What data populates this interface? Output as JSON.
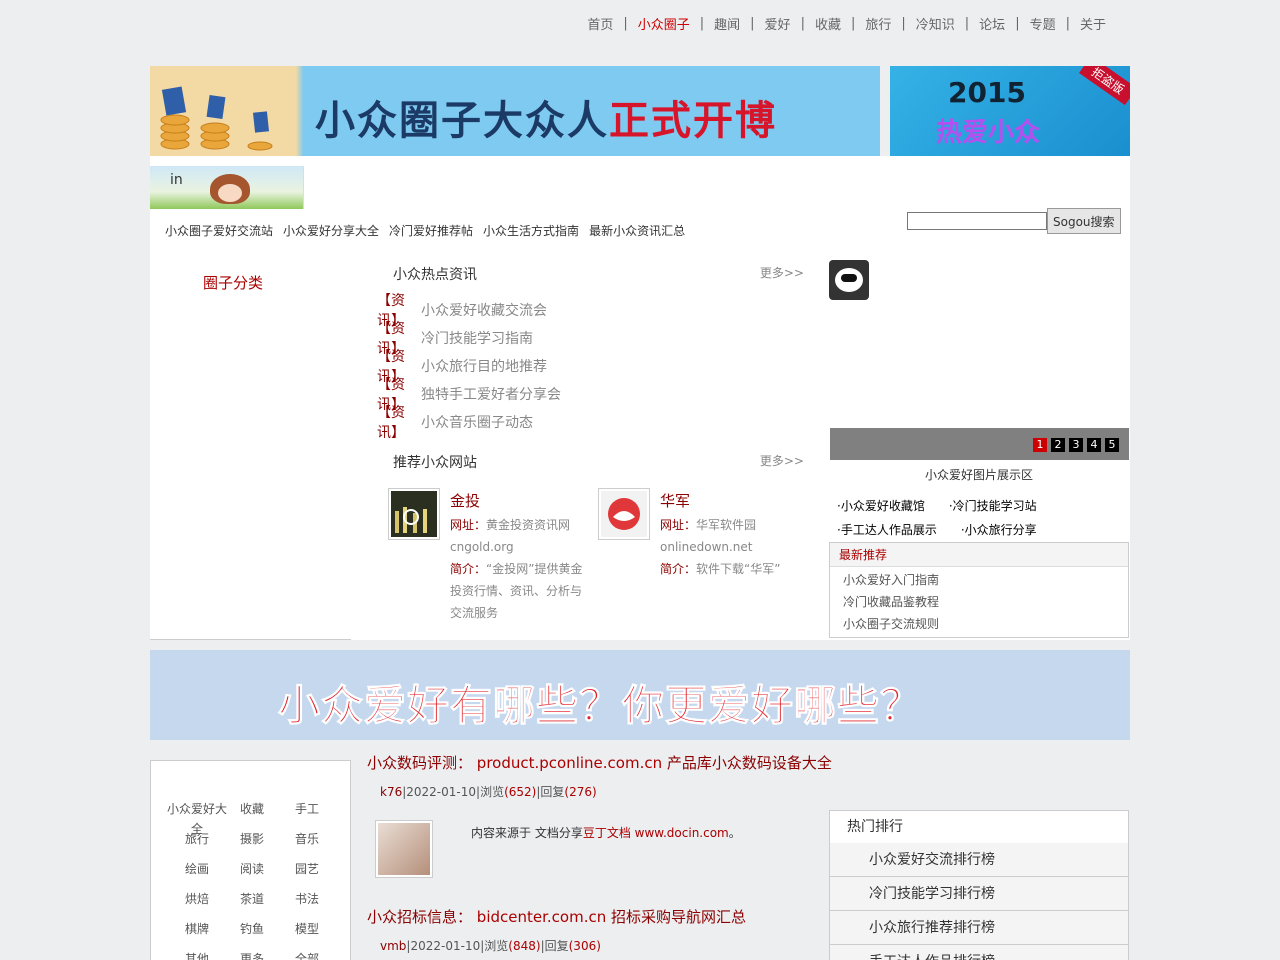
{
  "topnav": {
    "items": [
      {
        "label": "首页"
      },
      {
        "label": "小众圈子"
      },
      {
        "label": "趣闻"
      },
      {
        "label": "爱好"
      },
      {
        "label": "收藏"
      },
      {
        "label": "旅行"
      },
      {
        "label": "冷知识"
      },
      {
        "label": "论坛"
      },
      {
        "label": "专题"
      },
      {
        "label": "关于"
      }
    ],
    "active_index": 1,
    "separator": "|"
  },
  "banners": {
    "main": {
      "text_a": "小众圈子大众人",
      "text_b": "正式开博"
    },
    "side": {
      "year": "2015",
      "text": "热爱小众",
      "stamp": "拒盗版"
    },
    "mid": {
      "text": "小众爱好有哪些？你更爱好哪些？"
    }
  },
  "logo": {
    "text": "in"
  },
  "subnav": {
    "items": [
      "小众圈子爱好交流站",
      "小众爱好分享大全",
      "冷门爱好推荐帖",
      "小众生活方式指南",
      "最新小众资讯汇总"
    ]
  },
  "search": {
    "placeholder": "",
    "button": "Sogou搜索"
  },
  "left": {
    "head": "圈子分类"
  },
  "news": {
    "title": "小众热点资讯",
    "more": "更多>>",
    "rows": [
      {
        "tag": "【资讯】",
        "text": "小众爱好收藏交流会"
      },
      {
        "tag": "【资讯】",
        "text": "冷门技能学习指南"
      },
      {
        "tag": "【资讯】",
        "text": "小众旅行目的地推荐"
      },
      {
        "tag": "【资讯】",
        "text": "独特手工爱好者分享会"
      },
      {
        "tag": "【资讯】",
        "text": "小众音乐圈子动态"
      }
    ]
  },
  "sites": {
    "title": "推荐小众网站",
    "more": "更多>>",
    "cards": [
      {
        "name": "金投",
        "k1": "网址：",
        "v1": "黄金投资资讯网",
        "domain": "cngold.org",
        "k2": "简介：",
        "v2": "“金投网”提供黄金投资行情、资讯、分析与交流服务"
      },
      {
        "name": "华军",
        "k1": "网址：",
        "v1": "华军软件园",
        "domain": "onlinedown.net",
        "k2": "简介：",
        "v2": "软件下载“华军”"
      }
    ]
  },
  "slideshow": {
    "dots": [
      "1",
      "2",
      "3",
      "4",
      "5"
    ],
    "active_dot": 0,
    "caption": "小众爱好图片展示区",
    "hot_links": [
      "小众爱好收藏馆",
      "冷门技能学习站",
      "手工达人作品展示",
      "小众旅行分享"
    ]
  },
  "box": {
    "head": "最新推荐",
    "items": [
      "小众爱好入门指南",
      "冷门收藏品鉴教程",
      "小众圈子交流规则"
    ]
  },
  "bottom_grid": {
    "items": [
      "小众爱好大全",
      "收藏",
      "手工",
      "旅行",
      "摄影",
      "音乐",
      "绘画",
      "阅读",
      "园艺",
      "烘焙",
      "茶道",
      "书法",
      "棋牌",
      "钓鱼",
      "模型",
      "其他",
      "更多",
      "全部"
    ]
  },
  "articles": [
    {
      "title_pre": "小众数码评测：",
      "url": "product.pconline.com.cn",
      "title_post": "产品库小众数码设备大全",
      "user": "k76",
      "date": "2022-01-10",
      "views_label": "浏览",
      "views": "(652)",
      "replies_label": "回复",
      "replies": "(276)",
      "body_pre": "内容来源于 文档分享",
      "source": "豆丁文档 www.docin.com",
      "body_post": "。"
    },
    {
      "title_pre": "小众招标信息：",
      "url": "bidcenter.com.cn",
      "title_post": "招标采购导航网汇总",
      "user": "vmb",
      "date": "2022-01-10",
      "views_label": "浏览",
      "views": "(848)",
      "replies_label": "回复",
      "replies": "(306)"
    }
  ],
  "rank": {
    "head": "热门排行",
    "items": [
      "小众爱好交流排行榜",
      "冷门技能学习排行榜",
      "小众旅行推荐排行榜",
      "手工达人作品排行榜"
    ]
  }
}
